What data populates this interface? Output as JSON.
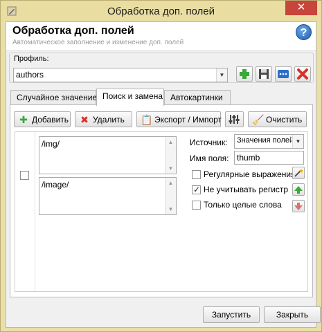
{
  "window": {
    "title": "Обработка доп. полей",
    "close_glyph": "✕"
  },
  "header": {
    "title": "Обработка доп. полей",
    "subtitle": "Автоматическое заполнение и изменение доп. полей",
    "help_glyph": "?"
  },
  "profile": {
    "label": "Профиль:",
    "value": "authors"
  },
  "profile_buttons": [
    {
      "name": "add-profile-button",
      "icon": "plus-icon"
    },
    {
      "name": "save-profile-button",
      "icon": "floppy-icon"
    },
    {
      "name": "rename-profile-button",
      "icon": "dots-icon"
    },
    {
      "name": "delete-profile-button",
      "icon": "red-x-icon"
    }
  ],
  "tabs": [
    {
      "label": "Случайное значение",
      "active": false
    },
    {
      "label": "Поиск и замена",
      "active": true
    },
    {
      "label": "Автокартинки",
      "active": false
    }
  ],
  "toolbar": {
    "add_label": "Добавить",
    "delete_label": "Удалить",
    "export_label": "Экспорт / Импорт",
    "clear_label": "Очистить"
  },
  "rule": {
    "enabled": false,
    "search": "/img/",
    "replace": "/image/",
    "source_label": "Источник:",
    "source_value": "Значения полей",
    "field_label": "Имя поля:",
    "field_value": "thumb",
    "regex_label": "Регулярные выражения",
    "regex_checked": false,
    "ignore_case_label": "Не учитывать регистр",
    "ignore_case_checked": true,
    "whole_words_label": "Только целые слова",
    "whole_words_checked": false
  },
  "footer": {
    "run_label": "Запустить",
    "close_label": "Закрыть"
  },
  "colors": {
    "title_bar": "#e9dda2",
    "close_button": "#c7453b",
    "accent_green": "#3aa83a",
    "accent_red": "#d6322b",
    "accent_blue": "#2a6fc8"
  }
}
